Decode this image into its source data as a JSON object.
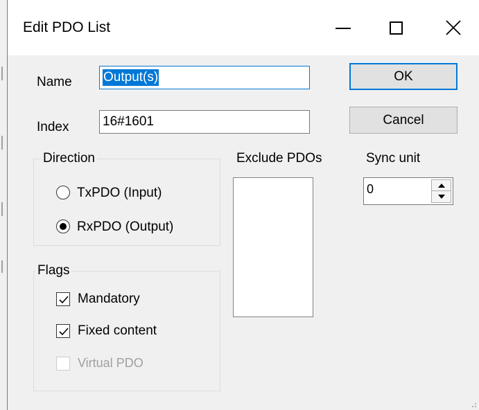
{
  "window": {
    "title": "Edit PDO List",
    "buttons": {
      "minimize": "minimize",
      "maximize": "maximize",
      "close": "close"
    }
  },
  "fields": {
    "name_label": "Name",
    "name_value": "Output(s)",
    "index_label": "Index",
    "index_value": "16#1601"
  },
  "buttons": {
    "ok": "OK",
    "cancel": "Cancel"
  },
  "direction": {
    "title": "Direction",
    "options": [
      {
        "label": "TxPDO (Input)",
        "checked": false
      },
      {
        "label": "RxPDO (Output)",
        "checked": true
      }
    ]
  },
  "flags": {
    "title": "Flags",
    "items": [
      {
        "label": "Mandatory",
        "checked": true,
        "enabled": true
      },
      {
        "label": "Fixed content",
        "checked": true,
        "enabled": true
      },
      {
        "label": "Virtual PDO",
        "checked": false,
        "enabled": false
      }
    ]
  },
  "exclude_pdos": {
    "label": "Exclude PDOs",
    "items": []
  },
  "sync_unit": {
    "label": "Sync unit",
    "value": "0"
  }
}
